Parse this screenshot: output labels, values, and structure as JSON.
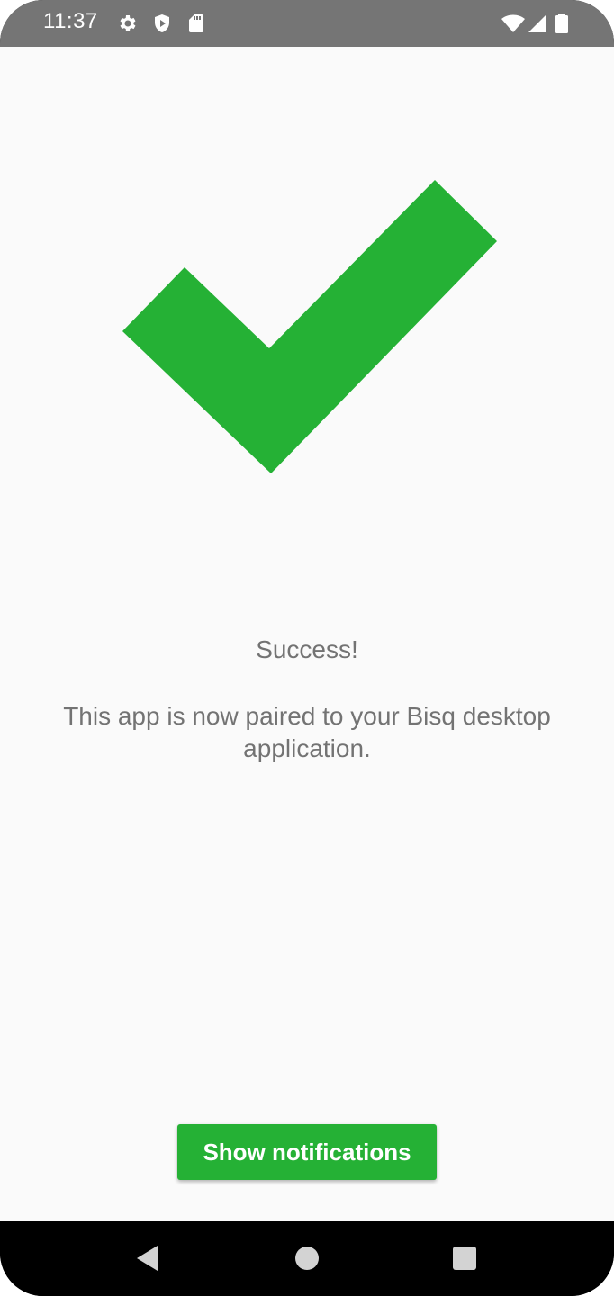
{
  "status_bar": {
    "time": "11:37",
    "left_icons": [
      "gear-icon",
      "shield-play-icon",
      "sd-card-icon"
    ],
    "right_icons": [
      "wifi-icon",
      "signal-icon",
      "battery-icon"
    ]
  },
  "main": {
    "icon": "checkmark-icon",
    "title": "Success!",
    "message": "This app is now paired to your Bisq desktop application.",
    "button_label": "Show notifications"
  },
  "nav_bar": {
    "icons": [
      "back-icon",
      "home-icon",
      "recents-icon"
    ]
  },
  "colors": {
    "accent": "#25b135",
    "status_bar_bg": "#757575",
    "screen_bg": "#fafafa",
    "text": "#737373"
  }
}
